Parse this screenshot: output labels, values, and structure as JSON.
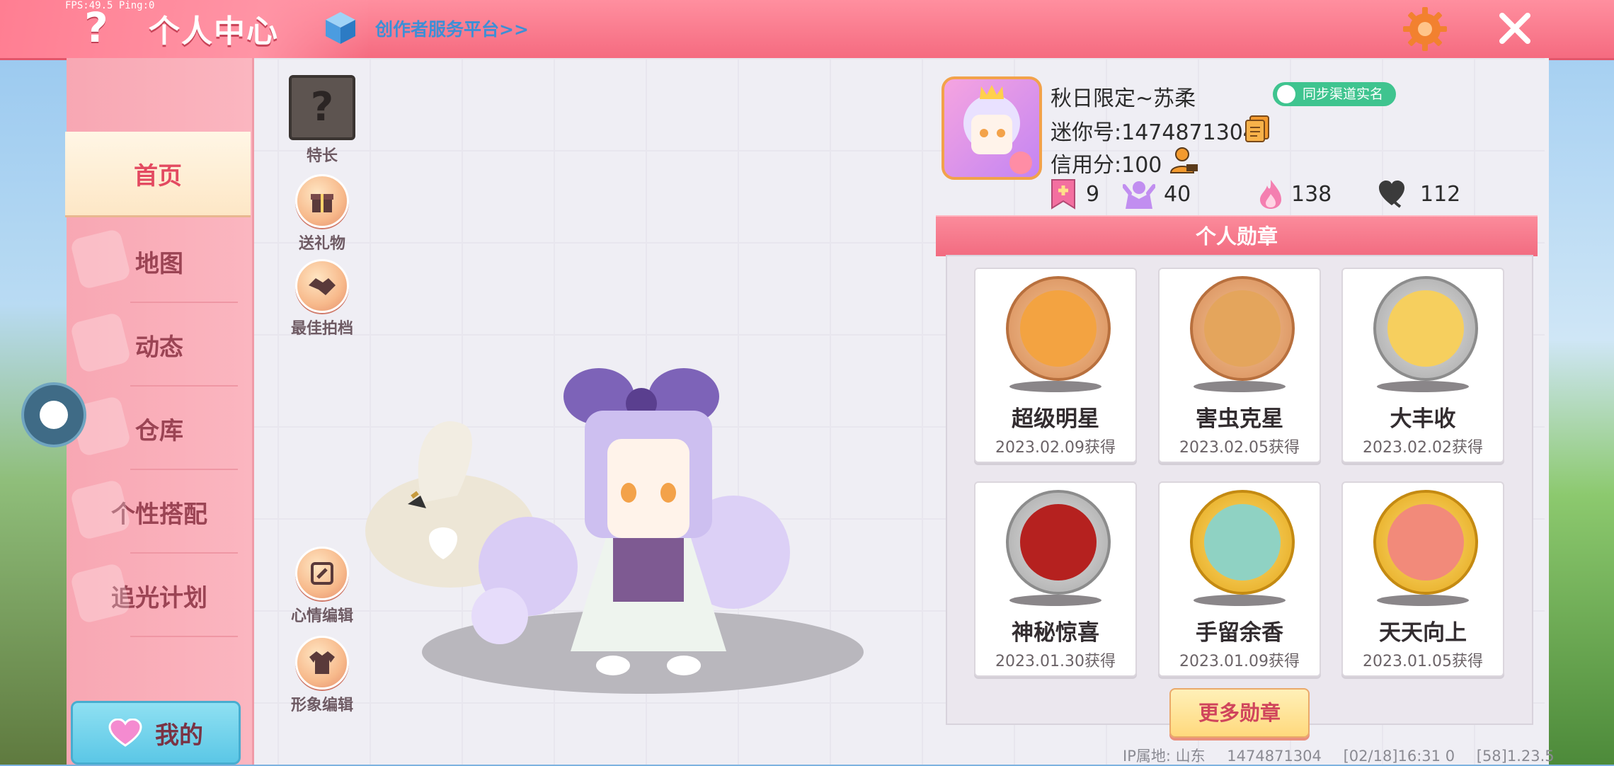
{
  "topbar": {
    "fps": "FPS:49.5  Ping:0",
    "help": "?",
    "title": "个人中心",
    "creator_link": "创作者服务平台>>",
    "colors": {
      "bar": "#f56b80",
      "link": "#3d8fd6",
      "gear": "#f2812f"
    }
  },
  "nav": {
    "items": [
      {
        "label": "首页",
        "active": true
      },
      {
        "label": "地图"
      },
      {
        "label": "动态"
      },
      {
        "label": "仓库"
      },
      {
        "label": "个性搭配"
      },
      {
        "label": "追光计划"
      }
    ],
    "my_button": "我的"
  },
  "tools": {
    "specialty": "特长",
    "specialty_glyph": "?",
    "gift": "送礼物",
    "best_photo": "最佳拍档",
    "mood_edit": "心情编辑",
    "look_edit": "形象编辑"
  },
  "profile": {
    "name": "秋日限定~苏柔",
    "mini_id": "迷你号:1474871304",
    "credit": "信用分:100",
    "sync_badge": "同步渠道实名",
    "stats": [
      {
        "icon": "bookmark-plus-icon",
        "value": "9"
      },
      {
        "icon": "fan-icon",
        "value": "40"
      },
      {
        "icon": "flame-icon",
        "value": "138"
      },
      {
        "icon": "heart-icon",
        "value": "112"
      }
    ]
  },
  "medals": {
    "header": "个人勋章",
    "items": [
      {
        "name": "超级明星",
        "date": "2023.02.09获得",
        "tier": "bronze",
        "color": "#7a4b33"
      },
      {
        "name": "害虫克星",
        "date": "2023.02.05获得",
        "tier": "bronze",
        "color": "#7e4fb8"
      },
      {
        "name": "大丰收",
        "date": "2023.02.02获得",
        "tier": "silver",
        "color": "#f0b64a"
      },
      {
        "name": "神秘惊喜",
        "date": "2023.01.30获得",
        "tier": "silver",
        "color": "#c12a2a"
      },
      {
        "name": "手留余香",
        "date": "2023.01.09获得",
        "tier": "gold",
        "color": "#7dc7b9"
      },
      {
        "name": "天天向上",
        "date": "2023.01.05获得",
        "tier": "gold",
        "color": "#e86d62"
      }
    ],
    "more_button": "更多勋章"
  },
  "footer": {
    "ip": "IP属地: 山东",
    "uid": "1474871304",
    "time": "[02/18]16:31 0",
    "version": "[58]1.23.5"
  }
}
